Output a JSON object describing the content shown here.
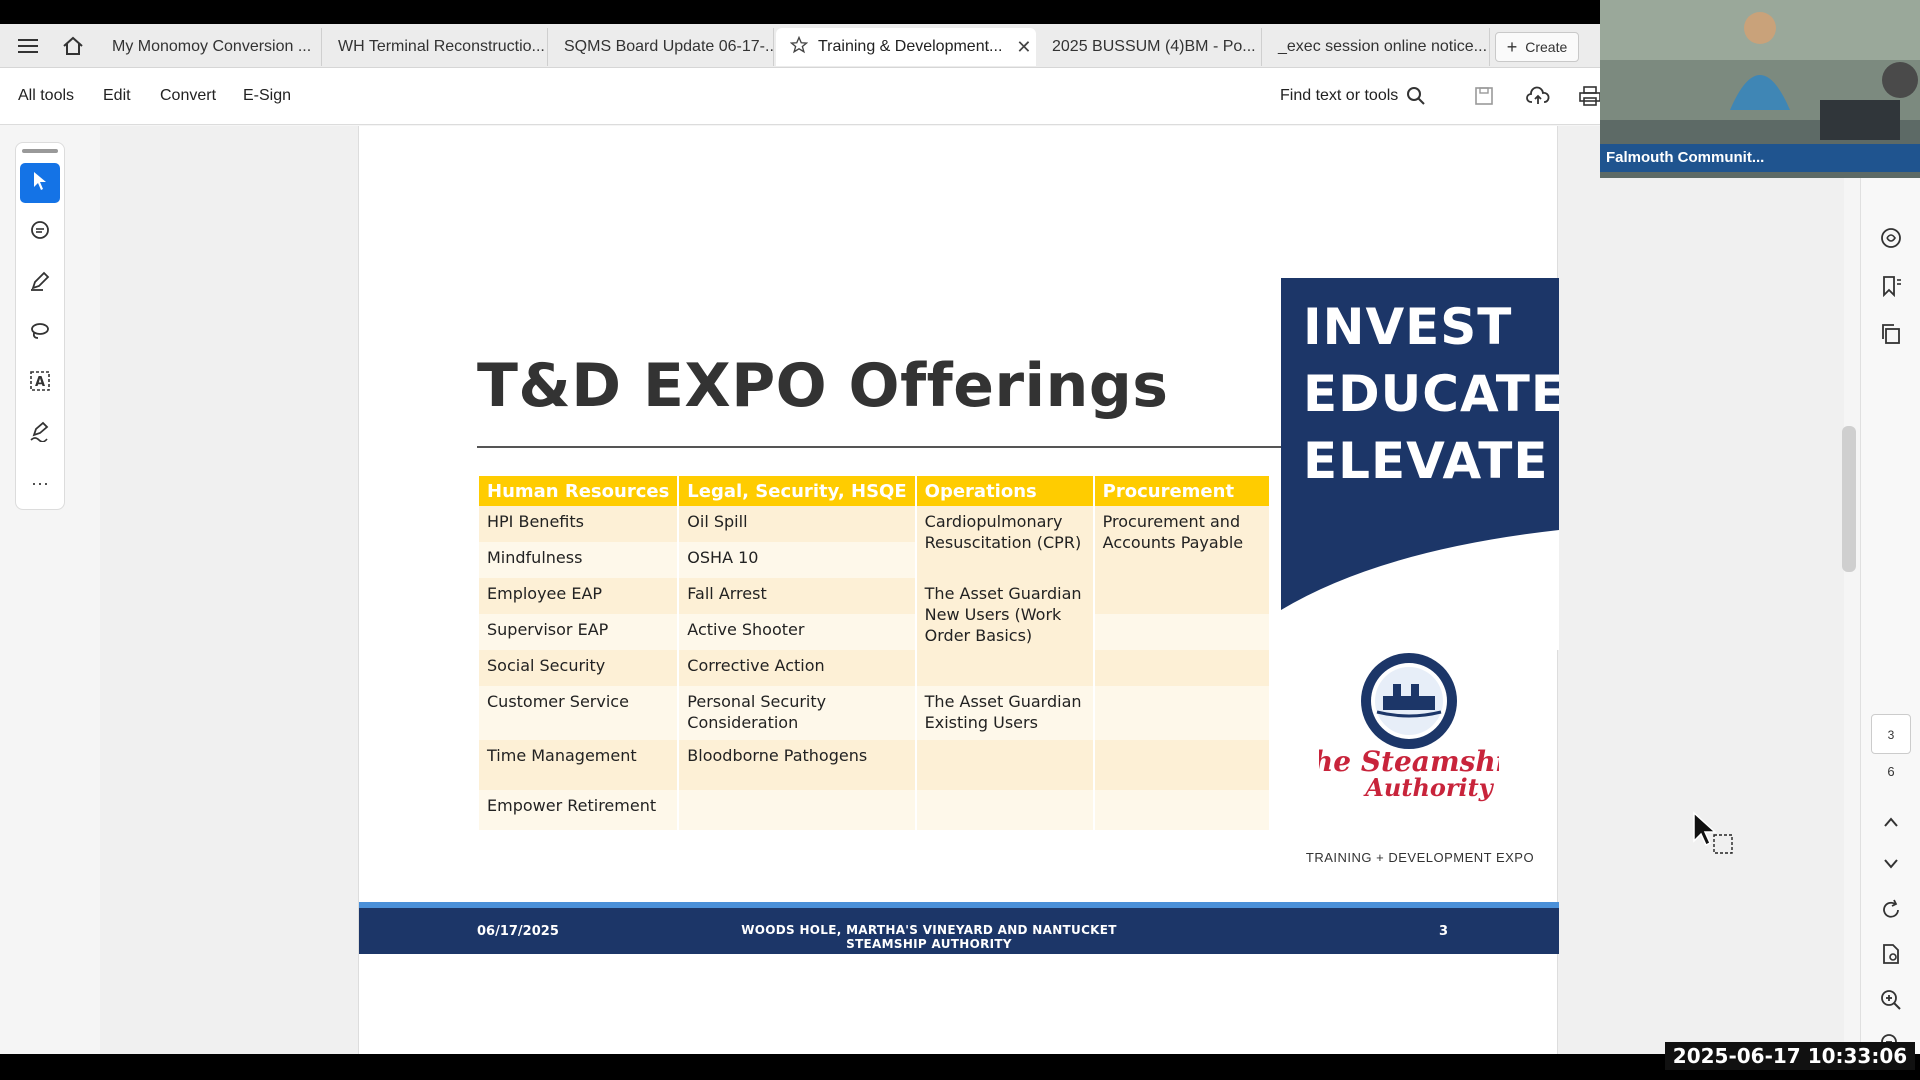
{
  "tabs": [
    {
      "label": "My Monomoy Conversion ..."
    },
    {
      "label": "WH Terminal Reconstructio..."
    },
    {
      "label": "SQMS Board Update 06-17-..."
    },
    {
      "label": "Training & Development..."
    },
    {
      "label": "2025 BUSSUM (4)BM - Po..."
    },
    {
      "label": "_exec session online notice..."
    }
  ],
  "create_label": "Create",
  "toolbar": {
    "menu": [
      "All tools",
      "Edit",
      "Convert",
      "E-Sign"
    ],
    "find_label": "Find text or tools"
  },
  "slide": {
    "title": "T&D EXPO Offerings",
    "table_headers": [
      "Human Resources",
      "Legal, Security, HSQE",
      "Operations",
      "Procurement"
    ],
    "hr": [
      "HPI Benefits",
      "Mindfulness",
      "Employee EAP",
      "Supervisor EAP",
      "Social Security",
      "Customer Service",
      "Time Management",
      "Empower Retirement"
    ],
    "legal": [
      "Oil Spill",
      "OSHA 10",
      "Fall Arrest",
      "Active Shooter",
      "Corrective Action",
      "Personal Security Consideration",
      "Bloodborne Pathogens",
      ""
    ],
    "operations": [
      "Cardiopulmonary Resuscitation (CPR)",
      "The Asset Guardian New Users (Work Order Basics)",
      "The Asset Guardian Existing Users"
    ],
    "procurement": [
      "Procurement and Accounts Payable"
    ],
    "invest_lines": [
      "INVEST",
      "EDUCATE",
      "ELEVATE"
    ],
    "expo_label": "TRAINING + DEVELOPMENT EXPO",
    "footer_date": "06/17/2025",
    "footer_org": "WOODS HOLE, MARTHA'S VINEYARD AND NANTUCKET STEAMSHIP AUTHORITY",
    "footer_page": "3"
  },
  "pager": {
    "current": "3",
    "total": "6"
  },
  "video": {
    "caption": "Falmouth Communit..."
  },
  "timestamp": "2025-06-17  10:33:06",
  "colors": {
    "accent": "#1473e6",
    "navy": "#1c3668",
    "gold": "#ffcc00"
  }
}
